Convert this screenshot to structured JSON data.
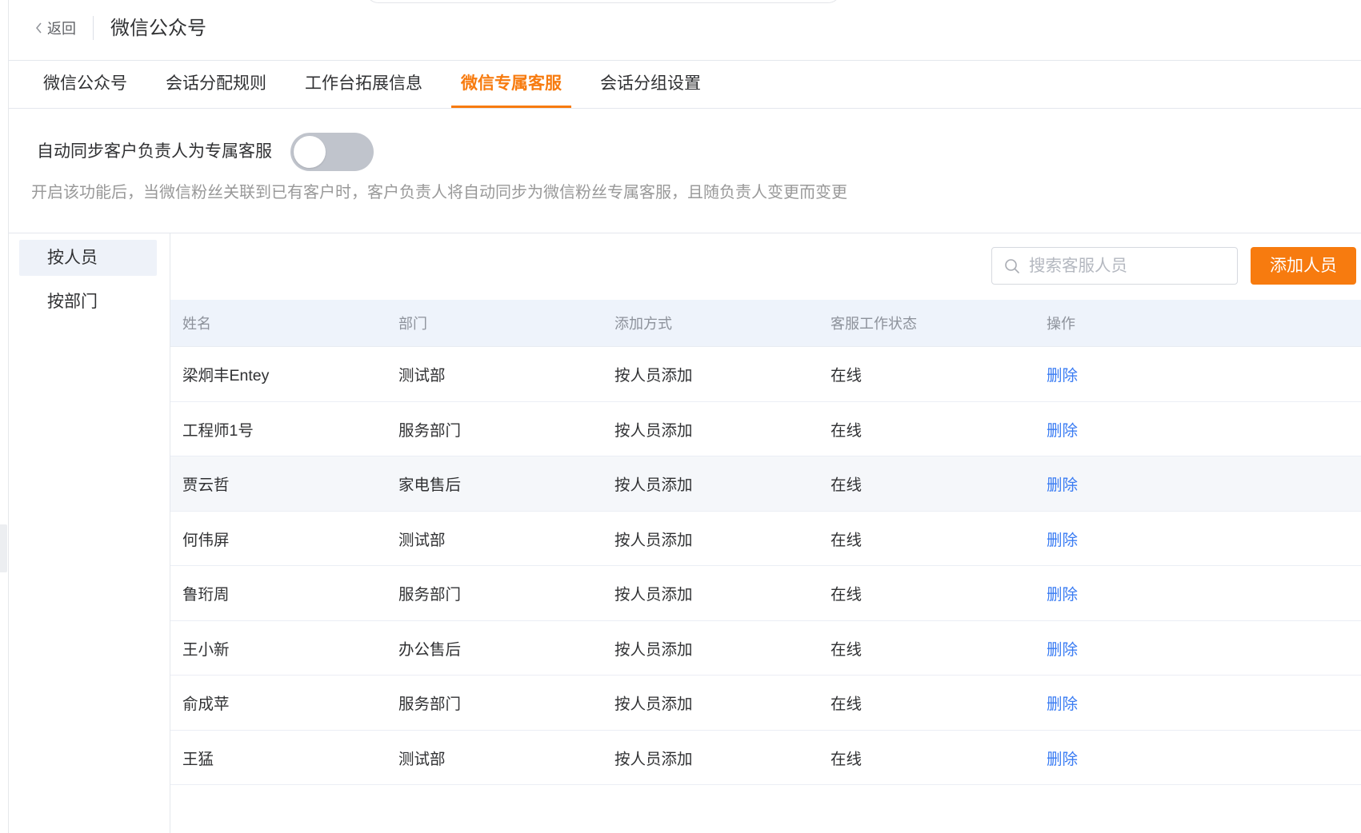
{
  "header": {
    "back_label": "返回",
    "title": "微信公众号"
  },
  "tabs": [
    {
      "label": "微信公众号",
      "active": false
    },
    {
      "label": "会话分配规则",
      "active": false
    },
    {
      "label": "工作台拓展信息",
      "active": false
    },
    {
      "label": "微信专属客服",
      "active": true
    },
    {
      "label": "会话分组设置",
      "active": false
    }
  ],
  "auto_sync": {
    "label": "自动同步客户负责人为专属客服",
    "enabled": false,
    "description": "开启该功能后，当微信粉丝关联到已有客户时，客户负责人将自动同步为微信粉丝专属客服，且随负责人变更而变更"
  },
  "sidebar": {
    "items": [
      {
        "label": "按人员",
        "selected": true
      },
      {
        "label": "按部门",
        "selected": false
      }
    ]
  },
  "toolbar": {
    "search_placeholder": "搜索客服人员",
    "search_value": "",
    "add_button_label": "添加人员"
  },
  "table": {
    "columns": [
      "姓名",
      "部门",
      "添加方式",
      "客服工作状态",
      "操作"
    ],
    "rows": [
      {
        "name": "梁炯丰Entey",
        "department": "测试部",
        "add_method": "按人员添加",
        "status": "在线",
        "action": "删除"
      },
      {
        "name": "工程师1号",
        "department": "服务部门",
        "add_method": "按人员添加",
        "status": "在线",
        "action": "删除"
      },
      {
        "name": "贾云哲",
        "department": "家电售后",
        "add_method": "按人员添加",
        "status": "在线",
        "action": "删除",
        "highlighted": true
      },
      {
        "name": "何伟屏",
        "department": "测试部",
        "add_method": "按人员添加",
        "status": "在线",
        "action": "删除"
      },
      {
        "name": "鲁珩周",
        "department": "服务部门",
        "add_method": "按人员添加",
        "status": "在线",
        "action": "删除"
      },
      {
        "name": "王小新",
        "department": "办公售后",
        "add_method": "按人员添加",
        "status": "在线",
        "action": "删除"
      },
      {
        "name": "俞成苹",
        "department": "服务部门",
        "add_method": "按人员添加",
        "status": "在线",
        "action": "删除"
      },
      {
        "name": "王猛",
        "department": "测试部",
        "add_method": "按人员添加",
        "status": "在线",
        "action": "删除"
      }
    ]
  },
  "icons": {
    "back": "chevron-left-icon",
    "search": "search-icon"
  },
  "colors": {
    "accent": "#f77b0f",
    "link": "#3a7cf3",
    "toggle_off": "#c0c4cc",
    "table_header_bg": "#eef3fb",
    "row_highlight_bg": "#f5f7fa",
    "sidebar_selected_bg": "#eef2f9"
  }
}
